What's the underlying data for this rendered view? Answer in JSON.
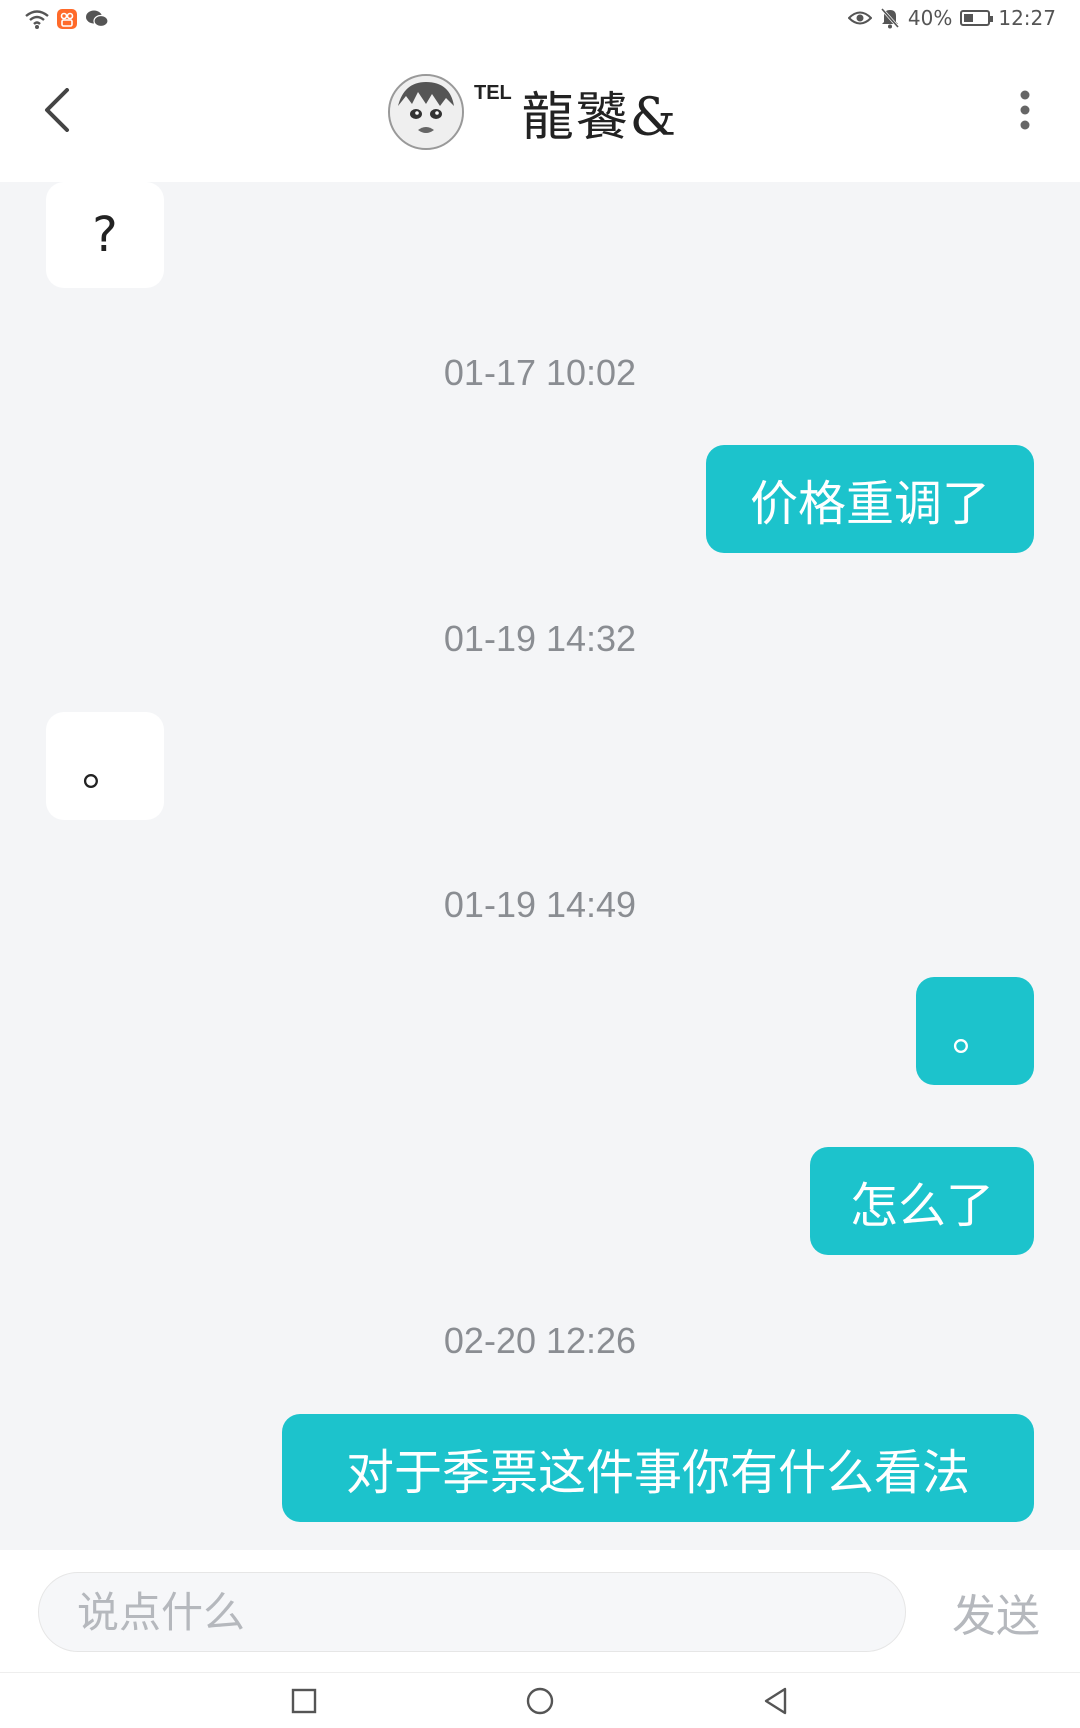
{
  "status_bar": {
    "battery_text": "40%",
    "battery_level": 0.4,
    "time": "12:27",
    "icons": [
      "wifi-icon",
      "app-notification-icon",
      "wechat-icon",
      "eye-icon",
      "mute-icon",
      "battery-icon"
    ]
  },
  "header": {
    "title_sup": "TEL",
    "title": "龍饕&",
    "back_icon": "chevron-left-icon",
    "more_icon": "more-vertical-icon"
  },
  "messages": [
    {
      "type": "in",
      "text": "?"
    },
    {
      "type": "time",
      "text": "01-17 10:02"
    },
    {
      "type": "out",
      "text": "价格重调了"
    },
    {
      "type": "time",
      "text": "01-19 14:32"
    },
    {
      "type": "in",
      "text": "。"
    },
    {
      "type": "time",
      "text": "01-19 14:49"
    },
    {
      "type": "out",
      "text": "。"
    },
    {
      "type": "out",
      "text": "怎么了"
    },
    {
      "type": "time",
      "text": "02-20 12:26"
    },
    {
      "type": "out",
      "text": "对于季票这件事你有什么看法"
    }
  ],
  "input": {
    "placeholder": "说点什么",
    "value": "",
    "send_label": "发送"
  },
  "colors": {
    "accent": "#1cc3cc",
    "background": "#f4f5f7",
    "timestamp": "#8a8d92"
  }
}
